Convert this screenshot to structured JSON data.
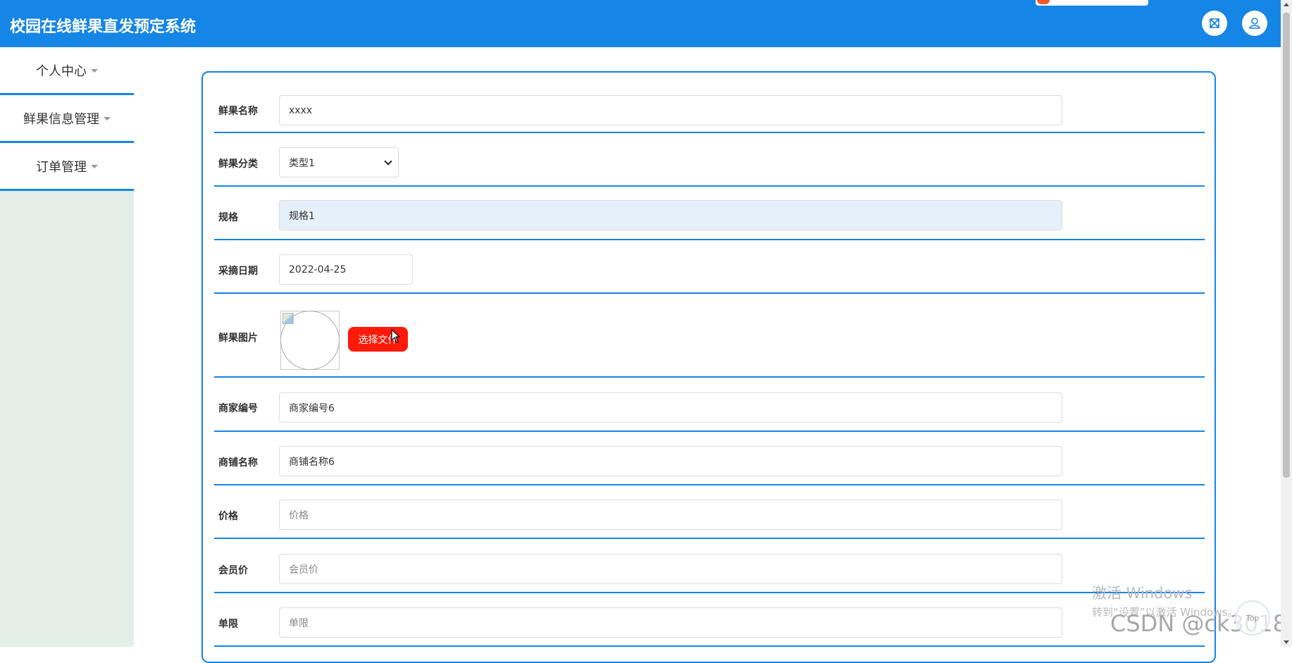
{
  "app": {
    "title": "校园在线鲜果直发预定系统"
  },
  "header": {
    "fullscreen_icon": "expand-icon",
    "user_icon": "user-icon"
  },
  "sidebar": {
    "items": [
      {
        "label": "个人中心"
      },
      {
        "label": "鲜果信息管理"
      },
      {
        "label": "订单管理"
      }
    ]
  },
  "form": {
    "name": {
      "label": "鲜果名称",
      "value": "xxxx"
    },
    "category": {
      "label": "鲜果分类",
      "value": "类型1"
    },
    "spec": {
      "label": "规格",
      "value": "规格1"
    },
    "date": {
      "label": "采摘日期",
      "value": "2022-04-25"
    },
    "image": {
      "label": "鲜果图片",
      "button": "选择文件"
    },
    "merchant_no": {
      "label": "商家编号",
      "value": "商家编号6"
    },
    "shop_name": {
      "label": "商铺名称",
      "value": "商铺名称6"
    },
    "price": {
      "label": "价格",
      "placeholder": "价格"
    },
    "member_price": {
      "label": "会员价",
      "placeholder": "会员价"
    },
    "limit": {
      "label": "单限",
      "placeholder": "单限"
    }
  },
  "overlay": {
    "top_button": "Top",
    "activate_title": "激活 Windows",
    "activate_hint": "转到“设置”以激活 Windows。",
    "watermark": "CSDN @ck3018"
  },
  "colors": {
    "primary": "#1585e6",
    "file_button": "#ff1a0a",
    "sidebar_bg": "#e4efe9"
  }
}
